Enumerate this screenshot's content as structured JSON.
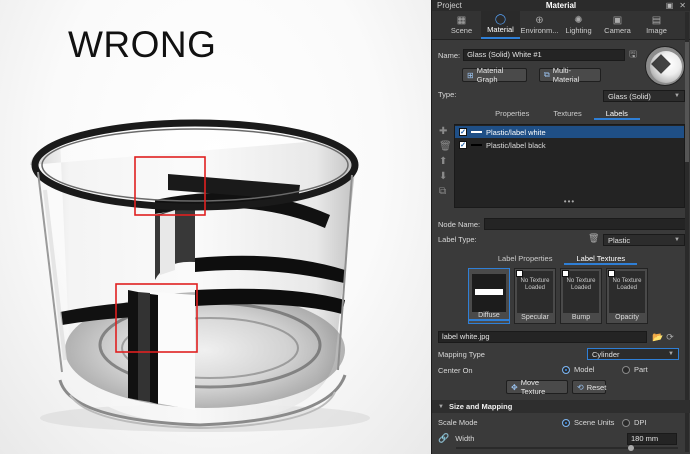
{
  "viewport": {
    "annotation_text": "WRONG"
  },
  "panel": {
    "topbar": {
      "project": "Project",
      "title": "Material"
    },
    "tabs": [
      {
        "label": "Scene",
        "icon": "scene-grid-icon"
      },
      {
        "label": "Material",
        "icon": "material-icon"
      },
      {
        "label": "Environm...",
        "icon": "globe-icon"
      },
      {
        "label": "Lighting",
        "icon": "bulb-icon"
      },
      {
        "label": "Camera",
        "icon": "camera-icon"
      },
      {
        "label": "Image",
        "icon": "image-icon"
      }
    ],
    "name_label": "Name:",
    "name_value": "Glass (Solid) White #1",
    "material_graph": "Material Graph",
    "multi_material": "Multi-Material",
    "type_label": "Type:",
    "type_value": "Glass (Solid)",
    "subtabs": [
      "Properties",
      "Textures",
      "Labels"
    ],
    "labels": [
      {
        "name": "Plastic/label white",
        "checked": true,
        "selected": true
      },
      {
        "name": "Plastic/label black",
        "checked": true,
        "selected": false
      }
    ],
    "list_more": "•••",
    "node_name_label": "Node Name:",
    "node_name_value": "",
    "label_type_label": "Label Type:",
    "label_type_value": "Plastic",
    "label_tabs": [
      "Label Properties",
      "Label Textures"
    ],
    "texture_slots": [
      {
        "name": "Diffuse",
        "placeholder": ""
      },
      {
        "name": "Specular",
        "placeholder": "No Texture Loaded"
      },
      {
        "name": "Bump",
        "placeholder": "No Texture Loaded"
      },
      {
        "name": "Opacity",
        "placeholder": "No Texture Loaded"
      }
    ],
    "texture_file": "label white.jpg",
    "mapping_type_label": "Mapping Type",
    "mapping_type_value": "Cylinder",
    "center_on_label": "Center On",
    "center_on_options": [
      "Model",
      "Part"
    ],
    "move_texture": "Move Texture",
    "reset": "Reset",
    "section_title": "Size and Mapping",
    "scale_mode_label": "Scale Mode",
    "scale_mode_options": [
      "Scene Units",
      "DPI"
    ],
    "width_label": "Width",
    "width_value": "180 mm"
  }
}
